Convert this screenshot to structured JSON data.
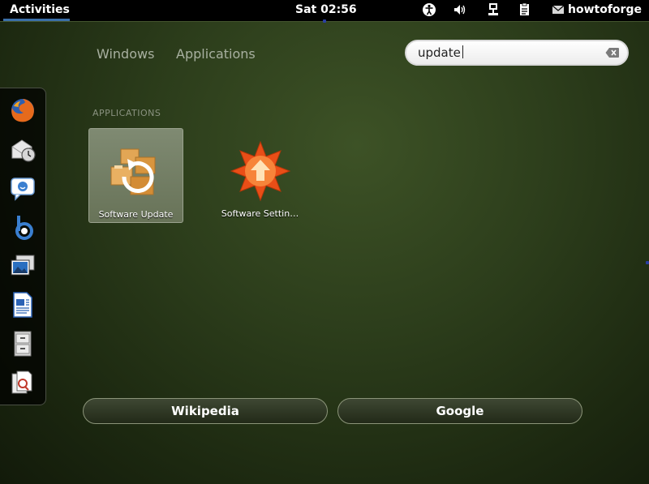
{
  "top_panel": {
    "activities_label": "Activities",
    "clock": "Sat 02:56",
    "username": "howtoforge",
    "tray_icons": [
      "accessibility-icon",
      "volume-icon",
      "network-icon",
      "clipboard-icon",
      "user-icon"
    ]
  },
  "view_tabs": {
    "windows": "Windows",
    "applications": "Applications"
  },
  "search": {
    "value": "update"
  },
  "dash": {
    "items": [
      "firefox-icon",
      "evolution-mail-icon",
      "empathy-chat-icon",
      "banshee-music-icon",
      "shotwell-photos-icon",
      "writer-document-icon",
      "file-cabinet-icon",
      "document-viewer-icon"
    ]
  },
  "results": {
    "section_title": "APPLICATIONS",
    "apps": [
      {
        "label": "Software Update",
        "icon": "software-update-icon",
        "selected": true
      },
      {
        "label": "Software Settin…",
        "icon": "software-settings-icon",
        "selected": false
      }
    ]
  },
  "search_providers": {
    "wikipedia": "Wikipedia",
    "google": "Google"
  },
  "colors": {
    "accent": "#3b6fa8",
    "background": "#2c3d1b"
  }
}
